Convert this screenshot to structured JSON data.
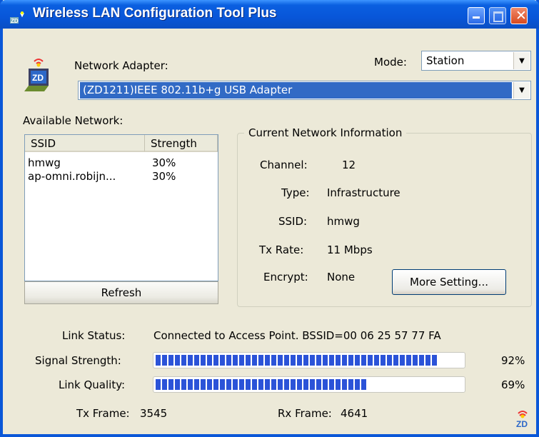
{
  "window": {
    "title": "Wireless LAN Configuration Tool Plus"
  },
  "adapter": {
    "label": "Network Adapter:",
    "selected": "(ZD1211)IEEE 802.11b+g USB Adapter"
  },
  "mode": {
    "label": "Mode:",
    "selected": "Station"
  },
  "available": {
    "label": "Available Network:",
    "columns": [
      "SSID",
      "Strength"
    ],
    "rows": [
      {
        "ssid": "hmwg",
        "strength": "30%"
      },
      {
        "ssid": "ap-omni.robijn...",
        "strength": "30%"
      }
    ],
    "refresh_label": "Refresh"
  },
  "current": {
    "title": "Current Network Information",
    "channel_label": "Channel:",
    "channel": "12",
    "type_label": "Type:",
    "type": "Infrastructure",
    "ssid_label": "SSID:",
    "ssid": "hmwg",
    "txrate_label": "Tx Rate:",
    "txrate": "11 Mbps",
    "encrypt_label": "Encrypt:",
    "encrypt": "None",
    "more_label": "More Setting..."
  },
  "status": {
    "link_status_label": "Link Status:",
    "link_status": "Connected to Access Point. BSSID=00 06 25 57 77 FA",
    "signal_label": "Signal Strength:",
    "signal_pct": "92%",
    "signal_value": 92,
    "quality_label": "Link Quality:",
    "quality_pct": "69%",
    "quality_value": 69,
    "tx_label": "Tx Frame:",
    "tx": "3545",
    "rx_label": "Rx Frame:",
    "rx": "4641"
  },
  "colors": {
    "titlebar": "#0856d9",
    "progress": "#2b53d8",
    "selection": "#316ac5"
  }
}
